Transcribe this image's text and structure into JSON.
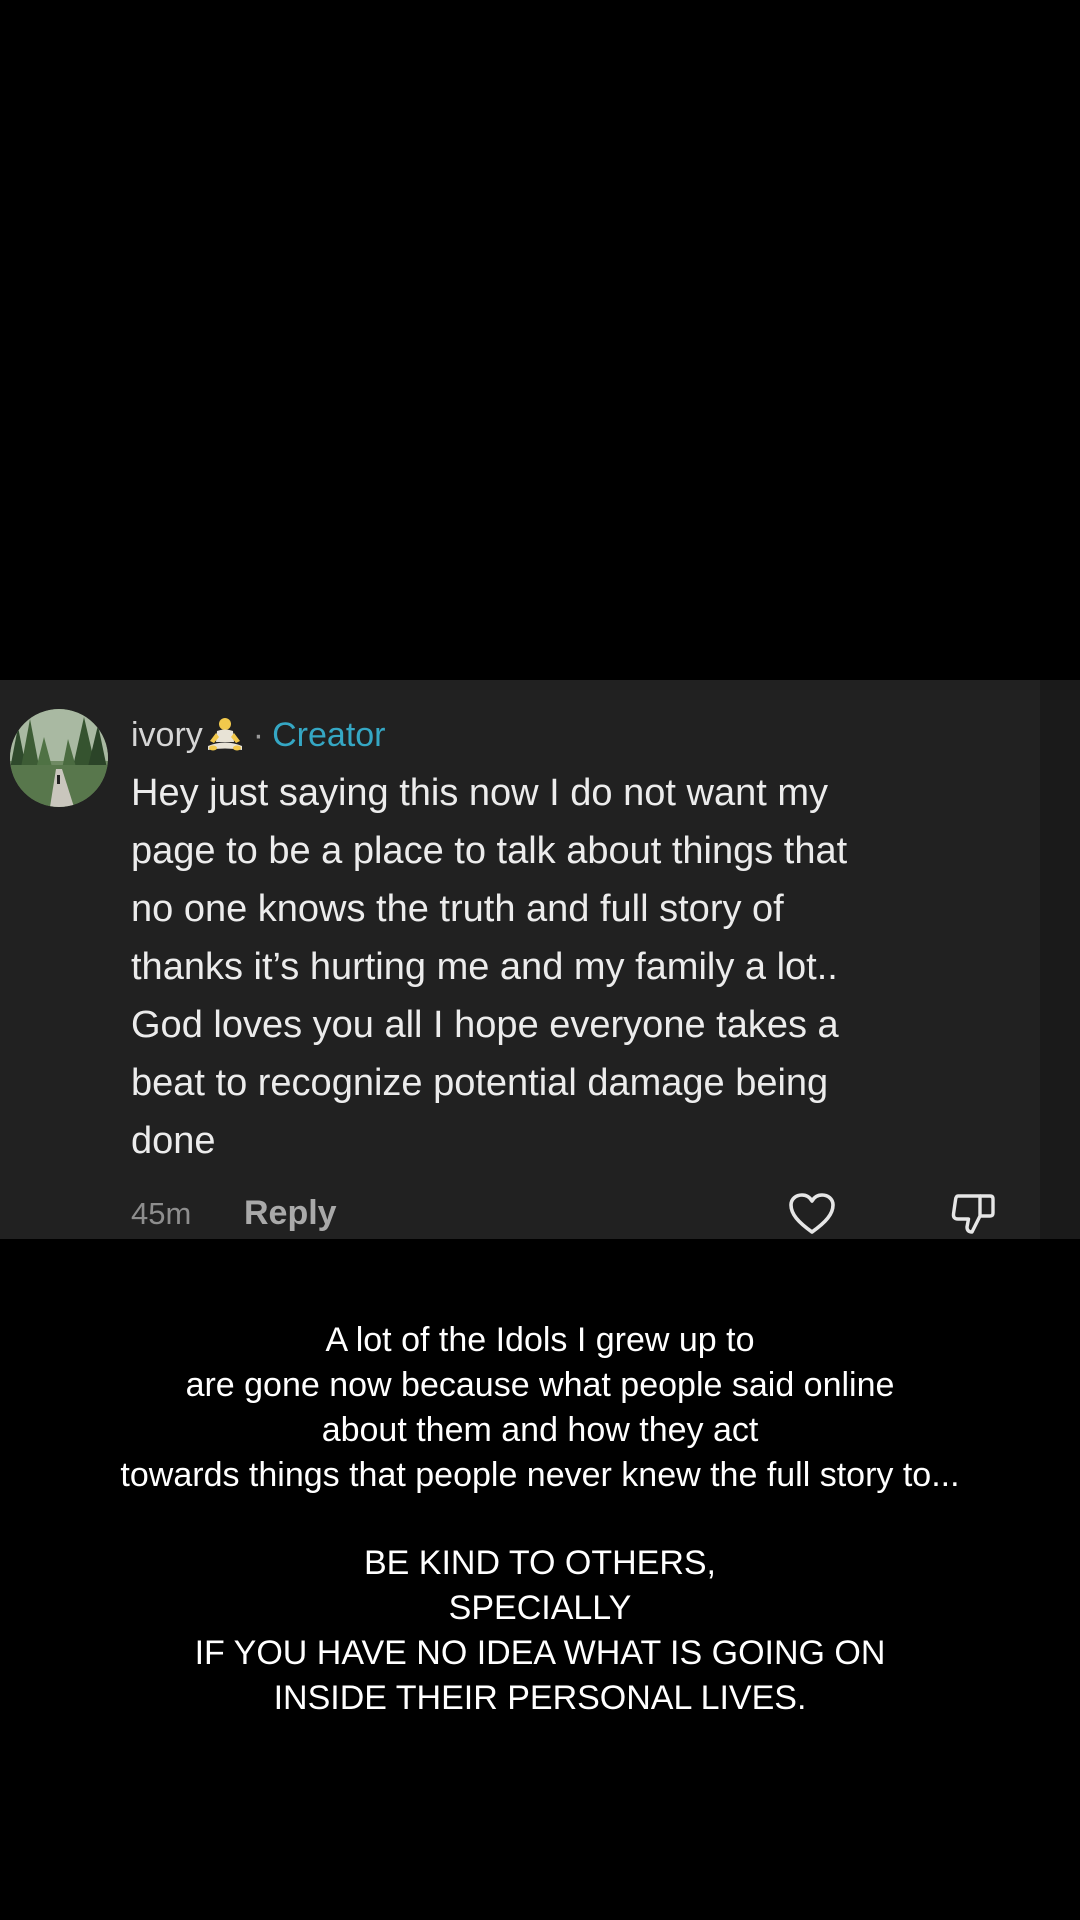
{
  "comment": {
    "username": "ivory",
    "user_emoji": "person-in-lotus-position",
    "separator": "·",
    "badge": "Creator",
    "text": "Hey just saying this now I do not want my\npage to be a place to talk about things that\nno one knows the truth and full story of\nthanks it’s hurting me and my family a lot..\nGod loves you all I hope everyone takes a\nbeat to recognize potential damage being\ndone",
    "timestamp": "45m",
    "reply_label": "Reply",
    "like_icon": "heart-outline-icon",
    "dislike_icon": "thumbs-down-outline-icon",
    "avatar": "forest-path-photo"
  },
  "caption": {
    "paragraph_1": [
      "A lot of the Idols I grew up to",
      "are gone now because what people said online",
      "about them and how they act",
      "towards things that people never knew the full story to..."
    ],
    "paragraph_2": [
      "BE KIND TO OTHERS,",
      "SPECIALLY",
      "IF YOU HAVE NO IDEA WHAT IS GOING ON",
      "INSIDE THEIR PERSONAL LIVES."
    ]
  },
  "colors": {
    "background": "#000000",
    "card": "#212121",
    "creator_badge": "#35a7c4",
    "comment_text": "#ececec",
    "muted_text": "#8e8e8e"
  }
}
